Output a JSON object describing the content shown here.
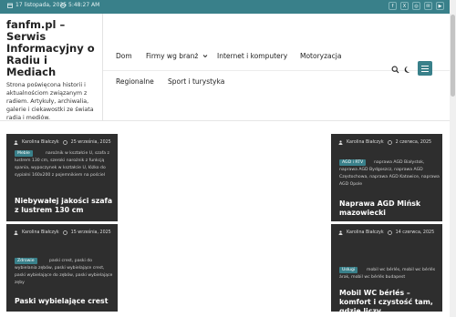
{
  "topbar": {
    "date": "17 listopada, 2025",
    "time": "5:48:27 AM",
    "social": [
      "f",
      "X",
      "◎",
      "✉",
      "▶"
    ]
  },
  "brand": {
    "title": "fanfm.pl – Serwis Informacyjny o Radiu i Mediach",
    "tagline": "Strona poświęcona historii i aktualnościom związanym z radiem. Artykuły, archiwalia, galerie i ciekawostki ze świata radia i mediów."
  },
  "nav": {
    "home": "Dom",
    "firms": "Firmy wg branż",
    "internet": "Internet i komputery",
    "moto": "Motoryzacja",
    "regional": "Regionalne",
    "sport": "Sport i turystyka"
  },
  "cards": [
    {
      "author": "Karolina Białczyk",
      "date": "25 września, 2025",
      "badge": "Meble",
      "tags": "narożnik w kształcie U, szafa z lustrem 130 cm, szeroki narożnik z funkcją spania, wypoczynek w kształcie U, łóżko do sypialni 160x200 z pojemnikiem na pościel",
      "headline": "Niebywałej jakości szafa z lustrem 130 cm"
    },
    {
      "author": "Karolina Białczyk",
      "date": "2 czerwca, 2025",
      "badge": "AGD i RTV",
      "tags": "naprawa AGD Białystok, naprawa AGD Bydgoszcz, naprawa AGD Częstochowa, naprawa AGD Katowice, naprawa AGD Opole",
      "headline": "Naprawa AGD Mińsk mazowiecki"
    },
    {
      "author": "Karolina Białczyk",
      "date": "15 września, 2025",
      "badge": "Zdrowie",
      "tags": "paski crest, paski do wybielania zębów, paski wybielające crest, paski wybielające do zębów, paski wybielające zęby",
      "headline": "Paski wybielające crest"
    },
    {
      "author": "Karolina Białczyk",
      "date": "14 czerwca, 2025",
      "badge": "Usługi",
      "tags": "mobil wc bérlés, mobil wc bérlés árak, mobil wc bérlés budapest",
      "headline": "Mobil WC bérlés – komfort i czystość tam, gdzie liczy…"
    }
  ]
}
